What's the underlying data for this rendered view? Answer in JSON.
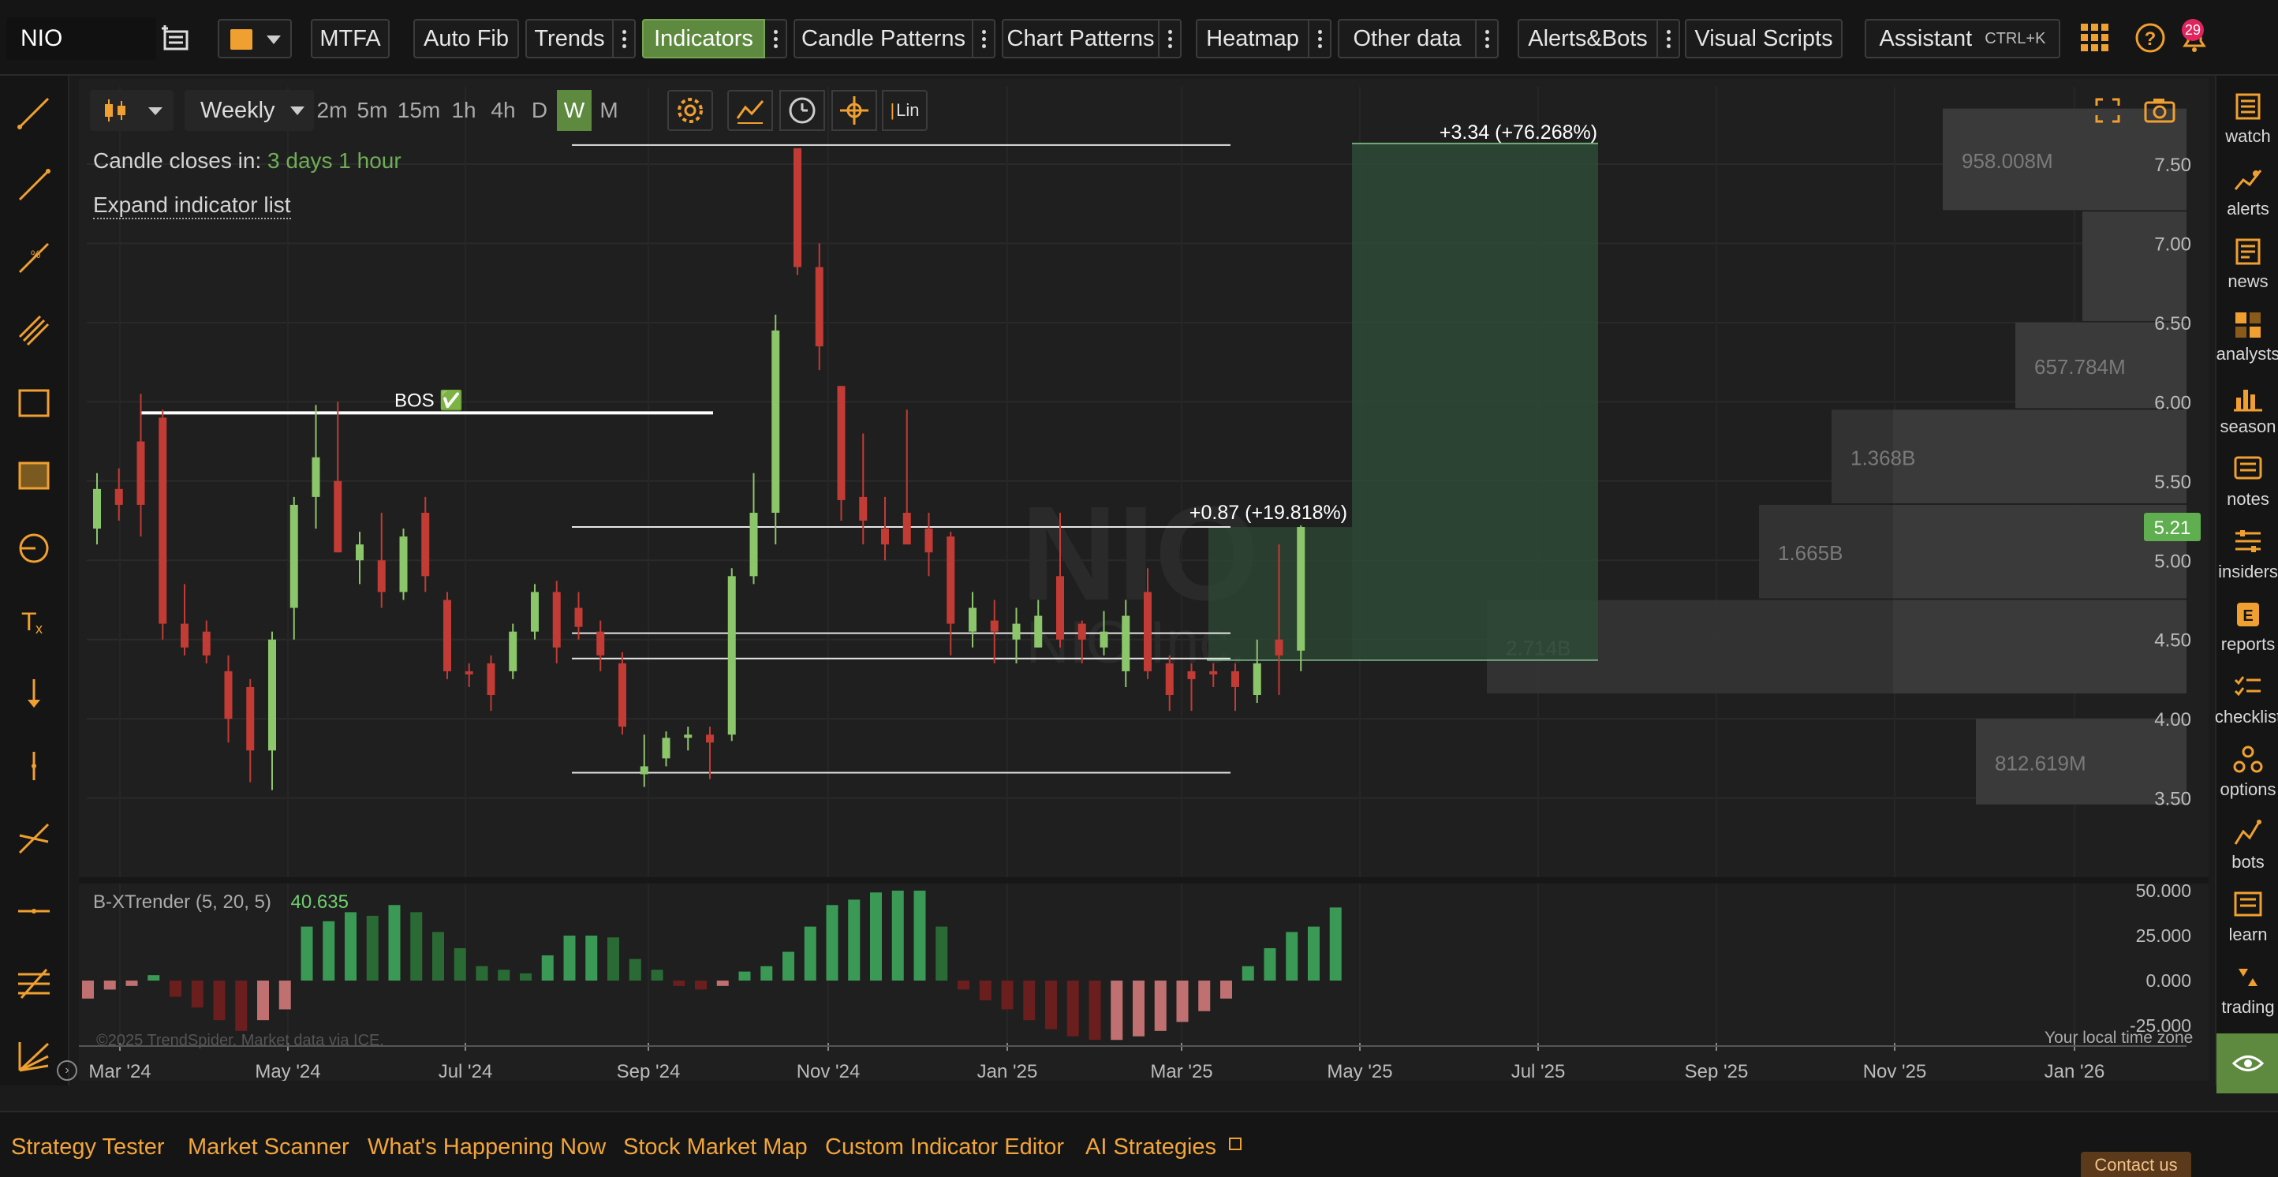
{
  "toolbar": {
    "symbol": "NIO",
    "mtfa": "MTFA",
    "auto_fib": "Auto Fib",
    "trends": "Trends",
    "indicators": "Indicators",
    "candle_patterns": "Candle Patterns",
    "chart_patterns": "Chart Patterns",
    "heatmap": "Heatmap",
    "other_data": "Other data",
    "alerts_bots": "Alerts&Bots",
    "visual_scripts": "Visual Scripts",
    "assistant": "Assistant",
    "assistant_shortcut": "CTRL+K",
    "notification_count": "29",
    "accent_color": "#f0a030"
  },
  "chart_controls": {
    "interval": "Weekly",
    "tf_buttons": [
      "2m",
      "5m",
      "15m",
      "1h",
      "4h",
      "D",
      "W",
      "M"
    ],
    "active_tf": "W",
    "scale_label": "Lin"
  },
  "chart_info": {
    "candle_closes_label": "Candle closes in:",
    "candle_closes_value": "3 days 1 hour",
    "expand_indicator_list": "Expand indicator list",
    "watermark_symbol": "NIO",
    "watermark_name": "NIO Inc.",
    "bos_label": "BOS ✅",
    "measure_big": "+3.34 (+76.268%)",
    "measure_small": "+0.87 (+19.818%)",
    "last_price": "5.21",
    "copyright": "©2025 TrendSpider. Market data via ICE.",
    "local_time": "Your local time zone"
  },
  "volume_profile": {
    "labels": [
      "958.008M",
      "657.784M",
      "1.368B",
      "1.665B",
      "2.714B",
      "812.619M"
    ]
  },
  "indicator": {
    "name": "B-XTrender (5, 20, 5)",
    "value": "40.635",
    "y_ticks": [
      "50.000",
      "25.000",
      "0.000",
      "-25.000"
    ]
  },
  "chart_data": {
    "type": "candlestick",
    "y_ticks": [
      "7.50",
      "7.00",
      "6.50",
      "6.00",
      "5.50",
      "5.00",
      "4.50",
      "4.00",
      "3.50"
    ],
    "x_ticks": [
      "Mar '24",
      "May '24",
      "Jul '24",
      "Sep '24",
      "Nov '24",
      "Jan '25",
      "Mar '25",
      "May '25",
      "Jul '25",
      "Sep '25",
      "Nov '25",
      "Jan '26"
    ],
    "ylim": [
      3.25,
      7.95
    ],
    "weeks": [
      "2024-03-04",
      "2024-03-11",
      "2024-03-18",
      "2024-03-25",
      "2024-04-01",
      "2024-04-08",
      "2024-04-15",
      "2024-04-22",
      "2024-04-29",
      "2024-05-06",
      "2024-05-13",
      "2024-05-20",
      "2024-05-27",
      "2024-06-03",
      "2024-06-10",
      "2024-06-17",
      "2024-06-24",
      "2024-07-01",
      "2024-07-08",
      "2024-07-15",
      "2024-07-22",
      "2024-07-29",
      "2024-08-05",
      "2024-08-12",
      "2024-08-19",
      "2024-08-26",
      "2024-09-02",
      "2024-09-09",
      "2024-09-16",
      "2024-09-23",
      "2024-09-30",
      "2024-10-07",
      "2024-10-14",
      "2024-10-21",
      "2024-10-28",
      "2024-11-04",
      "2024-11-11",
      "2024-11-18",
      "2024-11-25",
      "2024-12-02",
      "2024-12-09",
      "2024-12-16",
      "2024-12-23",
      "2024-12-30",
      "2025-01-06",
      "2025-01-13",
      "2025-01-20",
      "2025-01-27",
      "2025-02-03",
      "2025-02-10",
      "2025-02-17",
      "2025-02-24",
      "2025-03-03",
      "2025-03-10"
    ],
    "ohlc": [
      [
        5.2,
        5.55,
        5.1,
        5.45
      ],
      [
        5.45,
        5.58,
        5.25,
        5.35
      ],
      [
        5.75,
        6.05,
        5.15,
        5.35
      ],
      [
        5.9,
        5.95,
        4.5,
        4.6
      ],
      [
        4.6,
        4.85,
        4.4,
        4.45
      ],
      [
        4.55,
        4.62,
        4.35,
        4.4
      ],
      [
        4.3,
        4.4,
        3.85,
        4.0
      ],
      [
        4.2,
        4.25,
        3.6,
        3.8
      ],
      [
        3.8,
        4.55,
        3.55,
        4.5
      ],
      [
        4.7,
        5.4,
        4.5,
        5.35
      ],
      [
        5.4,
        5.98,
        5.2,
        5.65
      ],
      [
        5.5,
        6.0,
        5.05,
        5.05
      ],
      [
        5.0,
        5.18,
        4.85,
        5.1
      ],
      [
        5.0,
        5.3,
        4.7,
        4.8
      ],
      [
        4.8,
        5.2,
        4.75,
        5.15
      ],
      [
        5.3,
        5.4,
        4.8,
        4.9
      ],
      [
        4.75,
        4.8,
        4.25,
        4.3
      ],
      [
        4.3,
        4.35,
        4.2,
        4.28
      ],
      [
        4.35,
        4.4,
        4.05,
        4.15
      ],
      [
        4.3,
        4.6,
        4.25,
        4.55
      ],
      [
        4.55,
        4.85,
        4.5,
        4.8
      ],
      [
        4.8,
        4.87,
        4.35,
        4.45
      ],
      [
        4.7,
        4.8,
        4.5,
        4.58
      ],
      [
        4.55,
        4.62,
        4.3,
        4.4
      ],
      [
        4.35,
        4.42,
        3.9,
        3.95
      ],
      [
        3.65,
        3.9,
        3.57,
        3.7
      ],
      [
        3.75,
        3.92,
        3.7,
        3.88
      ],
      [
        3.88,
        3.95,
        3.8,
        3.9
      ],
      [
        3.9,
        3.95,
        3.62,
        3.85
      ],
      [
        3.9,
        4.95,
        3.86,
        4.9
      ],
      [
        4.9,
        5.55,
        4.85,
        5.3
      ],
      [
        5.3,
        6.55,
        5.1,
        6.45
      ],
      [
        7.6,
        7.6,
        6.8,
        6.85
      ],
      [
        6.85,
        7.0,
        6.2,
        6.35
      ],
      [
        6.1,
        6.1,
        5.25,
        5.38
      ],
      [
        5.4,
        5.8,
        5.1,
        5.25
      ],
      [
        5.2,
        5.4,
        5.0,
        5.1
      ],
      [
        5.3,
        5.95,
        5.1,
        5.1
      ],
      [
        5.2,
        5.3,
        4.9,
        5.05
      ],
      [
        5.15,
        5.18,
        4.4,
        4.6
      ],
      [
        4.55,
        4.8,
        4.45,
        4.7
      ],
      [
        4.62,
        4.75,
        4.35,
        4.55
      ],
      [
        4.5,
        4.7,
        4.35,
        4.6
      ],
      [
        4.45,
        4.75,
        4.45,
        4.65
      ],
      [
        4.9,
        5.3,
        4.45,
        4.5
      ],
      [
        4.6,
        4.62,
        4.35,
        4.5
      ],
      [
        4.45,
        4.68,
        4.4,
        4.55
      ],
      [
        4.3,
        4.75,
        4.2,
        4.65
      ],
      [
        4.8,
        4.95,
        4.25,
        4.3
      ],
      [
        4.35,
        4.4,
        4.05,
        4.15
      ],
      [
        4.3,
        4.35,
        4.05,
        4.25
      ],
      [
        4.3,
        4.35,
        4.2,
        4.28
      ],
      [
        4.3,
        4.35,
        4.05,
        4.2
      ],
      [
        4.15,
        4.5,
        4.1,
        4.35
      ]
    ],
    "ohlc_tail": [
      [
        4.5,
        5.1,
        4.15,
        4.4
      ],
      [
        4.43,
        5.22,
        4.3,
        5.21
      ]
    ],
    "indicator_values": [
      -10,
      -5,
      -3,
      3,
      -9,
      -15,
      -22,
      -28,
      -22,
      -16,
      30,
      33,
      38,
      36,
      42,
      38,
      27,
      18,
      8,
      6,
      4,
      14,
      25,
      25,
      24,
      12,
      6,
      -3,
      -5,
      -3,
      5,
      8,
      16,
      30,
      42,
      45,
      49,
      50,
      50,
      30,
      -5,
      -11,
      -16,
      -22,
      -27,
      -31,
      -33,
      -33,
      -31,
      -28,
      -23,
      -17,
      -10,
      8,
      18,
      27,
      30,
      40.635
    ],
    "bar_colors": {
      "pos_strong": "#3a9a55",
      "pos_weak": "#2a6b35",
      "neg_strong": "#6a1e1e",
      "neg_weak": "#c07070"
    },
    "candle_colors": {
      "up": "#8cc66b",
      "down": "#c23b35"
    }
  },
  "bottom_bar": {
    "links": [
      "Strategy Tester",
      "Market Scanner",
      "What's Happening Now",
      "Stock Market Map",
      "Custom Indicator Editor",
      "AI Strategies"
    ],
    "contact": "Contact us"
  },
  "right_panel": {
    "items": [
      "watch",
      "alerts",
      "news",
      "analysts",
      "season",
      "notes",
      "insiders",
      "reports",
      "checklist",
      "options",
      "bots",
      "learn",
      "trading"
    ]
  }
}
